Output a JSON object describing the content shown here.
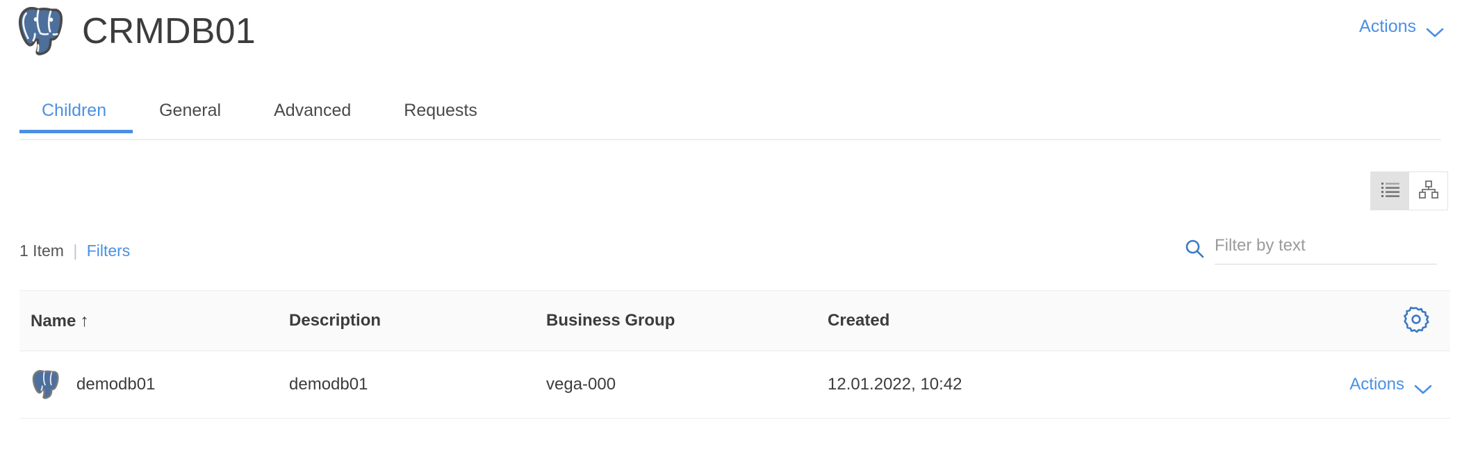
{
  "header": {
    "title": "CRMDB01",
    "logo_icon": "postgresql-elephant-icon",
    "actions_label": "Actions",
    "actions_chevron_icon": "chevron-down-icon"
  },
  "tabs": [
    {
      "label": "Children",
      "active": true
    },
    {
      "label": "General",
      "active": false
    },
    {
      "label": "Advanced",
      "active": false
    },
    {
      "label": "Requests",
      "active": false
    }
  ],
  "view_toggle": {
    "list_icon": "list-view-icon",
    "hierarchy_icon": "hierarchy-view-icon",
    "active": "list"
  },
  "meta": {
    "item_count": "1 Item",
    "separator": "|",
    "filters_label": "Filters"
  },
  "search": {
    "icon": "search-icon",
    "placeholder": "Filter by text",
    "value": ""
  },
  "table": {
    "columns": [
      {
        "label": "Name",
        "sorted": "asc",
        "sort_arrow": "↑"
      },
      {
        "label": "Description"
      },
      {
        "label": "Business Group"
      },
      {
        "label": "Created"
      }
    ],
    "settings_icon": "gear-icon",
    "rows": [
      {
        "icon": "postgresql-elephant-icon",
        "name": "demodb01",
        "description": "demodb01",
        "business_group": "vega-000",
        "created": "12.01.2022, 10:42",
        "actions_label": "Actions",
        "actions_chevron_icon": "chevron-down-icon"
      }
    ]
  },
  "colors": {
    "accent_blue": "#4a90e2",
    "postgres_blue": "#336791",
    "text_dark": "#3c3c3c",
    "header_bg": "#fafafa",
    "border": "#ececec"
  }
}
